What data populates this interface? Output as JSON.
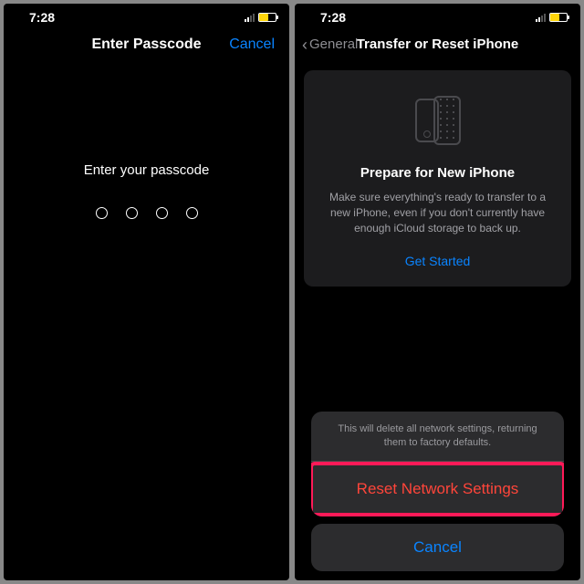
{
  "status": {
    "time": "7:28"
  },
  "left": {
    "nav_title": "Enter Passcode",
    "nav_cancel": "Cancel",
    "prompt": "Enter your passcode"
  },
  "right": {
    "nav_back": "General",
    "nav_title": "Transfer or Reset iPhone",
    "card": {
      "title": "Prepare for New iPhone",
      "desc": "Make sure everything's ready to transfer to a new iPhone, even if you don't currently have enough iCloud storage to back up.",
      "cta": "Get Started"
    },
    "sheet": {
      "message": "This will delete all network settings, returning them to factory defaults.",
      "reset": "Reset Network Settings",
      "cancel": "Cancel"
    }
  }
}
